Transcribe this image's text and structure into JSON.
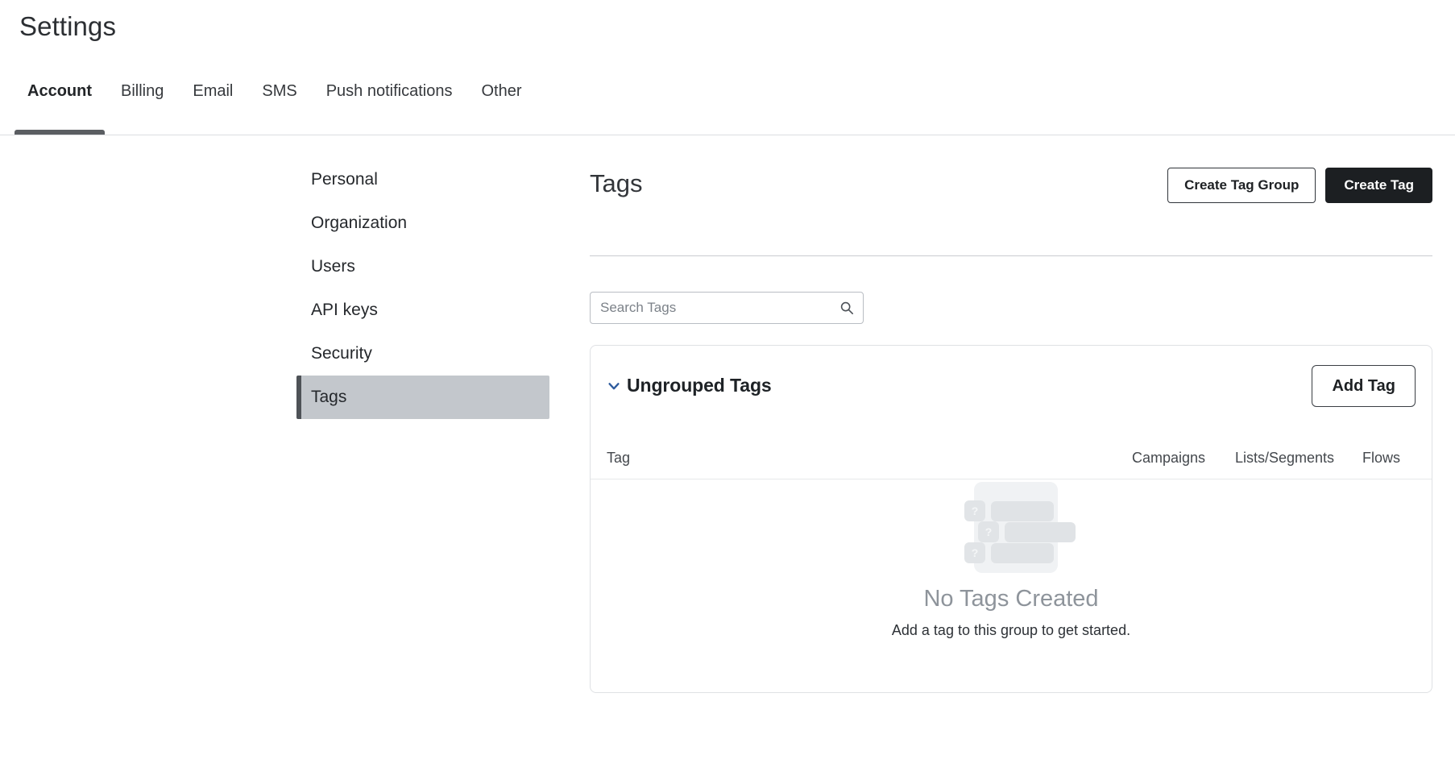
{
  "header": {
    "title": "Settings"
  },
  "tabs": [
    {
      "label": "Account",
      "active": true
    },
    {
      "label": "Billing",
      "active": false
    },
    {
      "label": "Email",
      "active": false
    },
    {
      "label": "SMS",
      "active": false
    },
    {
      "label": "Push notifications",
      "active": false
    },
    {
      "label": "Other",
      "active": false
    }
  ],
  "settings_nav": [
    {
      "label": "Personal",
      "selected": false
    },
    {
      "label": "Organization",
      "selected": false
    },
    {
      "label": "Users",
      "selected": false
    },
    {
      "label": "API keys",
      "selected": false
    },
    {
      "label": "Security",
      "selected": false
    },
    {
      "label": "Tags",
      "selected": true
    }
  ],
  "main": {
    "title": "Tags",
    "actions": {
      "create_tag_group": "Create Tag Group",
      "create_tag": "Create Tag"
    },
    "search": {
      "placeholder": "Search Tags",
      "value": "",
      "icon": "search-icon"
    },
    "group": {
      "name": "Ungrouped Tags",
      "expanded": true,
      "chevron_icon": "chevron-down-icon",
      "add_tag_label": "Add Tag",
      "columns": [
        "Tag",
        "Campaigns",
        "Lists/Segments",
        "Flows"
      ],
      "rows": [],
      "empty_state": {
        "title": "No Tags Created",
        "subtitle": "Add a tag to this group to get started.",
        "illustration_badges": [
          "?",
          "?",
          "?"
        ]
      }
    }
  },
  "colors": {
    "accent_blue": "#2f5c9e",
    "primary_button": "#1c1f22",
    "selected_nav_bg": "#c3c7cc",
    "selected_nav_bar": "#4e5257",
    "tab_underline": "#5b5e62",
    "muted_text": "#8e949b"
  }
}
